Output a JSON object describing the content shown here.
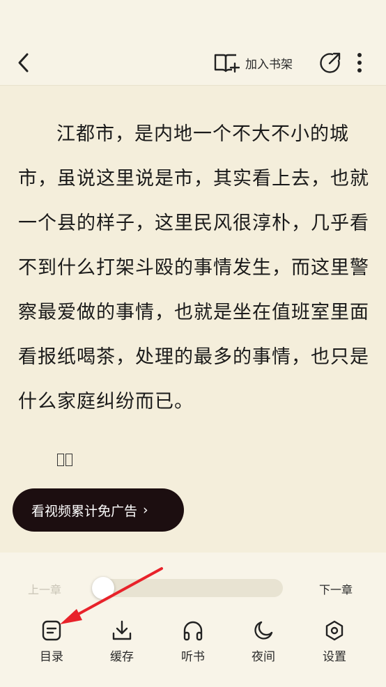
{
  "header": {
    "add_to_bookshelf_label": "加入书架",
    "icons": {
      "back": "back-chevron-icon",
      "bookshelf": "book-add-icon",
      "share": "share-icon",
      "more": "more-vertical-icon"
    }
  },
  "reader": {
    "paragraph": "江都市，是内地一个不大不小的城市，虽说这里说是市，其实看上去，也就一个县的样子，这里民风很淳朴，几乎看不到什么打架斗殴的事情发生，而这里警察最爱做的事情，也就是坐在值班室里面看报纸喝茶，处理的最多的事情，也只是什么家庭纠纷而已。"
  },
  "ad_banner": {
    "label": "看视频累计免广告",
    "chevron": "›"
  },
  "chapter_nav": {
    "prev_label": "上一章",
    "next_label": "下一章",
    "progress": 0.0
  },
  "toolbar": {
    "items": [
      {
        "label": "目录",
        "icon": "catalog-icon"
      },
      {
        "label": "缓存",
        "icon": "download-icon"
      },
      {
        "label": "听书",
        "icon": "headphones-icon"
      },
      {
        "label": "夜间",
        "icon": "moon-icon"
      },
      {
        "label": "设置",
        "icon": "settings-hexagon-icon"
      }
    ]
  },
  "colors": {
    "background": "#f4eedb",
    "ad_pill": "#1c0e10",
    "annotation_arrow": "#e8222a"
  }
}
